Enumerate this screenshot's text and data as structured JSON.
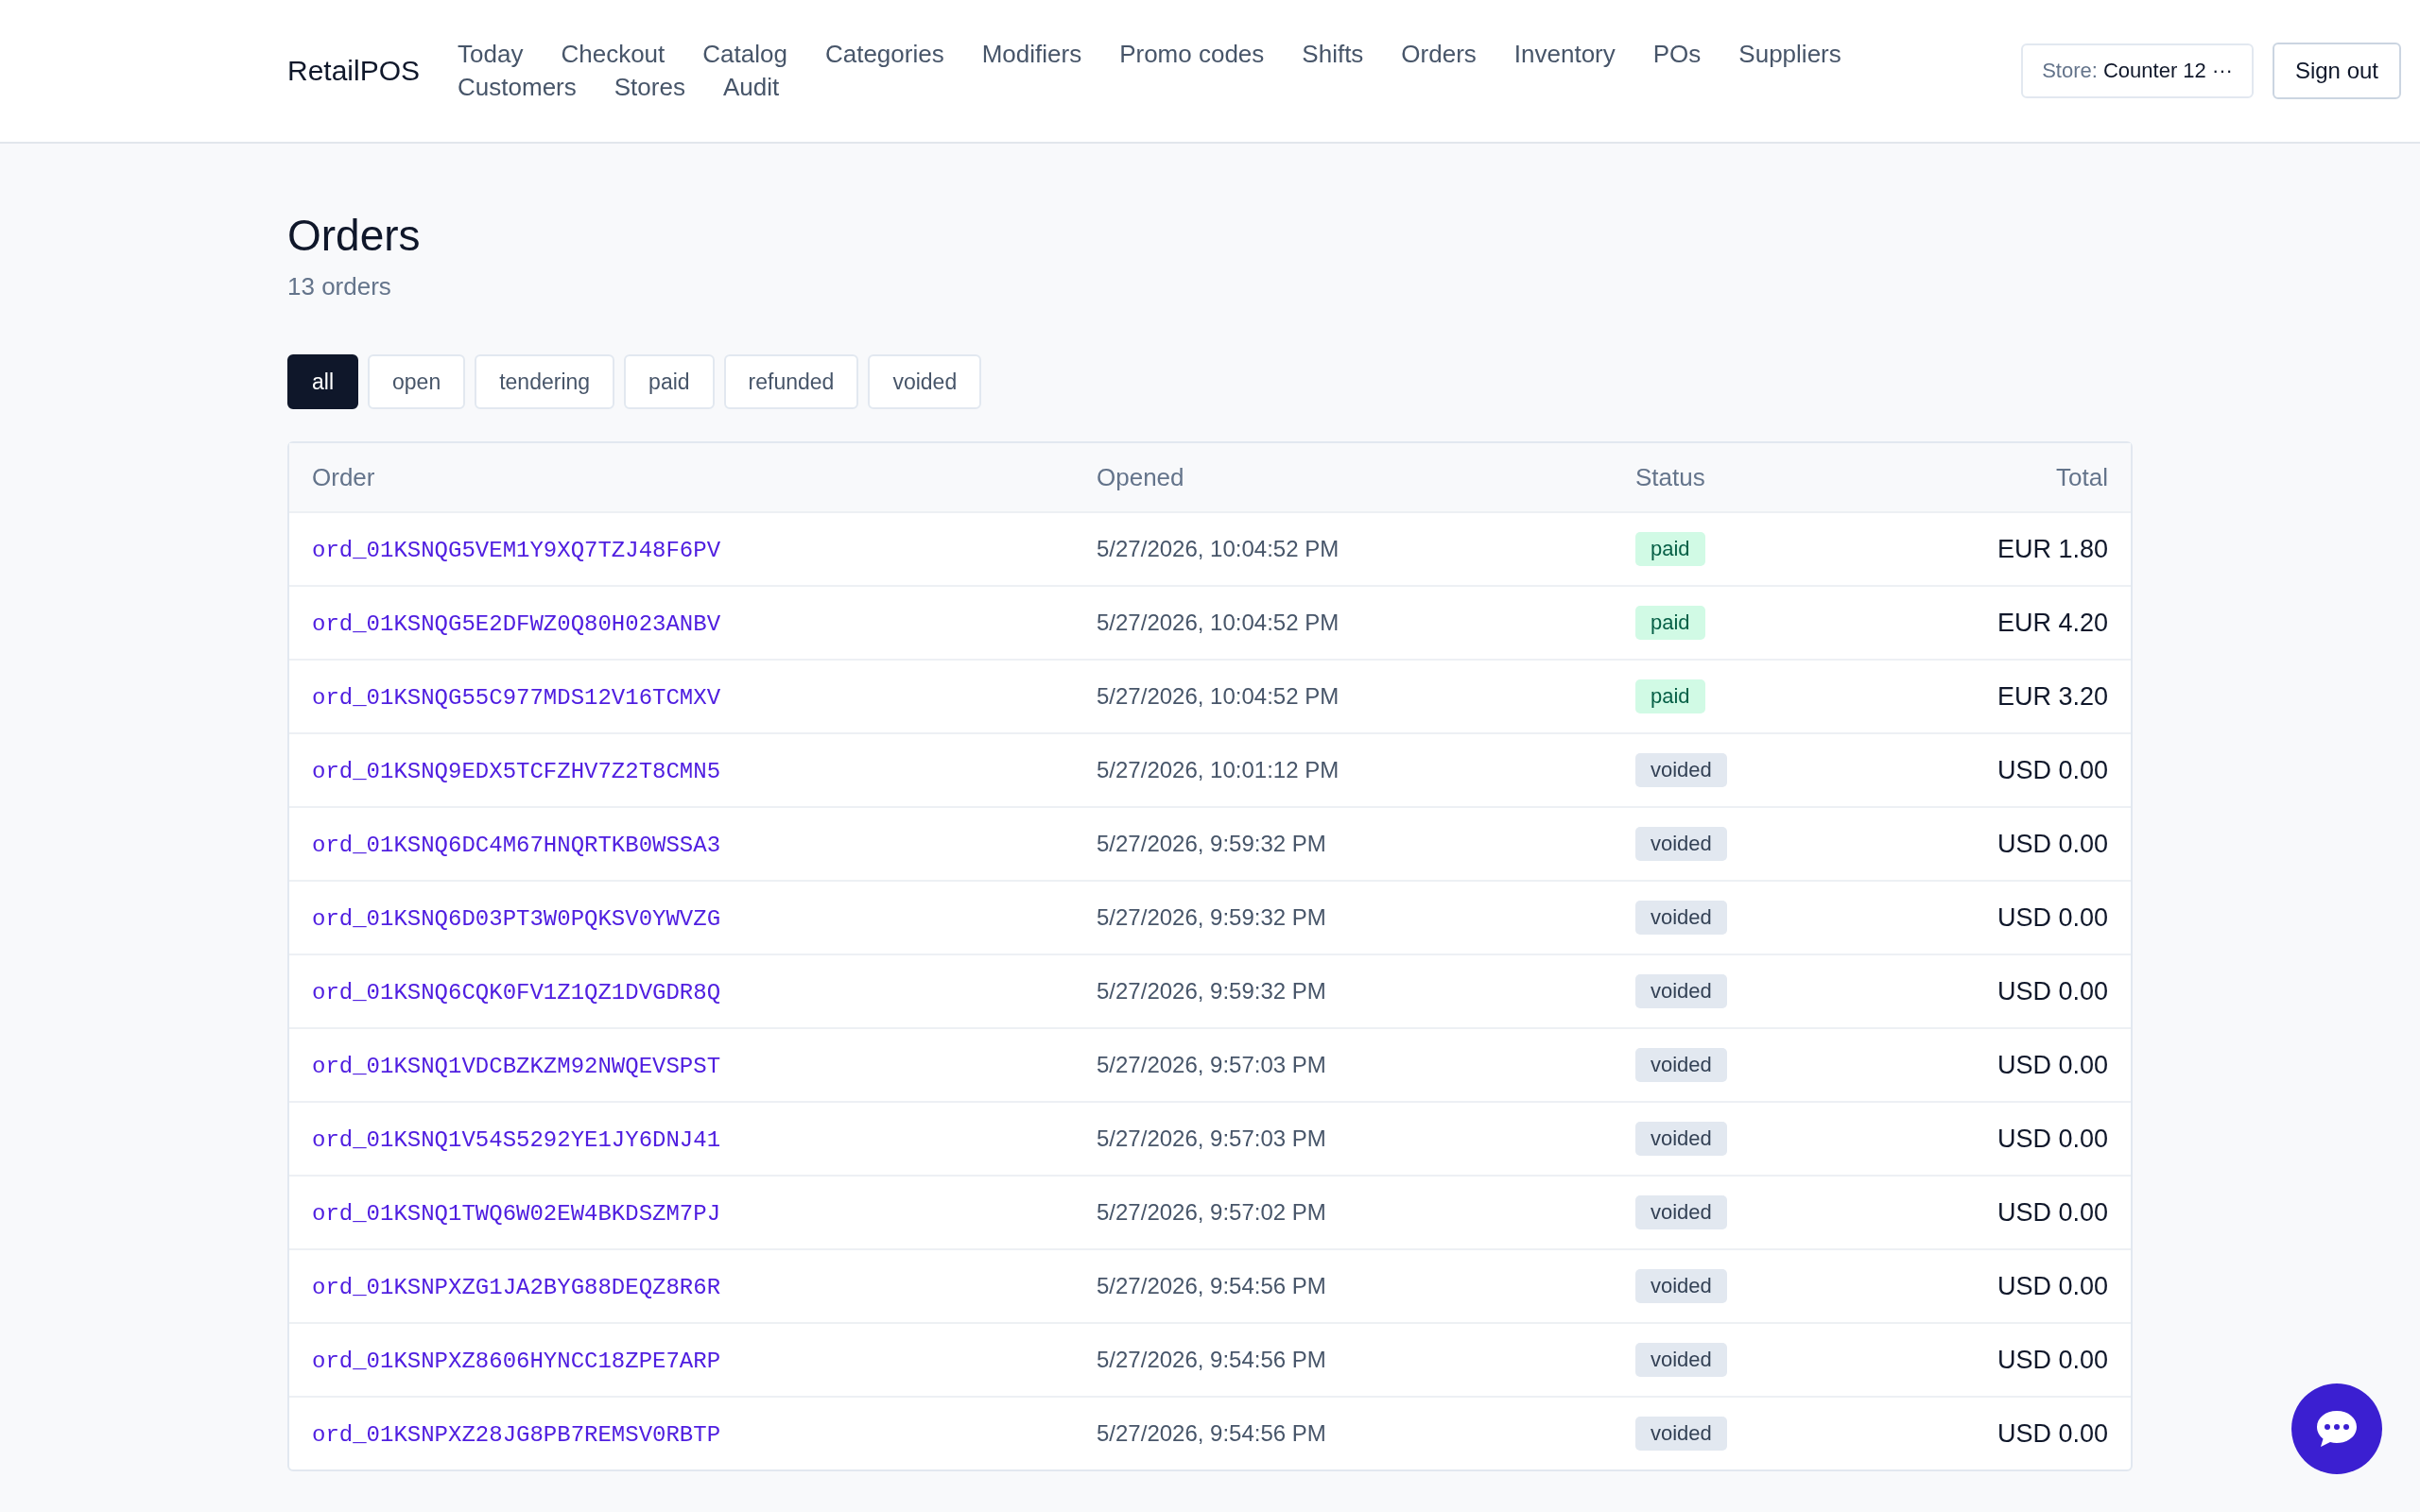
{
  "brand": "RetailPOS",
  "nav": [
    {
      "label": "Today",
      "selected": false
    },
    {
      "label": "Checkout",
      "selected": false
    },
    {
      "label": "Catalog",
      "selected": false
    },
    {
      "label": "Categories",
      "selected": false
    },
    {
      "label": "Modifiers",
      "selected": false
    },
    {
      "label": "Promo codes",
      "selected": false
    },
    {
      "label": "Shifts",
      "selected": false
    },
    {
      "label": "Orders",
      "selected": false
    },
    {
      "label": "Inventory",
      "selected": false
    },
    {
      "label": "POs",
      "selected": false
    },
    {
      "label": "Suppliers",
      "selected": false
    },
    {
      "label": "Customers",
      "selected": false
    },
    {
      "label": "Stores",
      "selected": false
    },
    {
      "label": "Audit",
      "selected": false
    }
  ],
  "store_select": {
    "label": "Store:",
    "value": "Counter 12 ···"
  },
  "sign_out": "Sign out",
  "page": {
    "title": "Orders",
    "subtitle": "13 orders"
  },
  "filters": [
    {
      "label": "all",
      "selected": true
    },
    {
      "label": "open",
      "selected": false
    },
    {
      "label": "tendering",
      "selected": false
    },
    {
      "label": "paid",
      "selected": false
    },
    {
      "label": "refunded",
      "selected": false
    },
    {
      "label": "voided",
      "selected": false
    }
  ],
  "table": {
    "columns": [
      "Order",
      "Opened",
      "Status",
      "Total"
    ],
    "rows": [
      {
        "order": "ord_01KSNQG5VEM1Y9XQ7TZJ48F6PV",
        "opened": "5/27/2026, 10:04:52 PM",
        "status": "paid",
        "kind": "paid",
        "total": "EUR 1.80"
      },
      {
        "order": "ord_01KSNQG5E2DFWZ0Q80H023ANBV",
        "opened": "5/27/2026, 10:04:52 PM",
        "status": "paid",
        "kind": "paid",
        "total": "EUR 4.20"
      },
      {
        "order": "ord_01KSNQG55C977MDS12V16TCMXV",
        "opened": "5/27/2026, 10:04:52 PM",
        "status": "paid",
        "kind": "paid",
        "total": "EUR 3.20"
      },
      {
        "order": "ord_01KSNQ9EDX5TCFZHV7Z2T8CMN5",
        "opened": "5/27/2026, 10:01:12 PM",
        "status": "voided",
        "kind": "voided",
        "total": "USD 0.00"
      },
      {
        "order": "ord_01KSNQ6DC4M67HNQRTKB0WSSA3",
        "opened": "5/27/2026, 9:59:32 PM",
        "status": "voided",
        "kind": "voided",
        "total": "USD 0.00"
      },
      {
        "order": "ord_01KSNQ6D03PT3W0PQKSV0YWVZG",
        "opened": "5/27/2026, 9:59:32 PM",
        "status": "voided",
        "kind": "voided",
        "total": "USD 0.00"
      },
      {
        "order": "ord_01KSNQ6CQK0FV1Z1QZ1DVGDR8Q",
        "opened": "5/27/2026, 9:59:32 PM",
        "status": "voided",
        "kind": "voided",
        "total": "USD 0.00"
      },
      {
        "order": "ord_01KSNQ1VDCBZKZM92NWQEVSPST",
        "opened": "5/27/2026, 9:57:03 PM",
        "status": "voided",
        "kind": "voided",
        "total": "USD 0.00"
      },
      {
        "order": "ord_01KSNQ1V54S5292YE1JY6DNJ41",
        "opened": "5/27/2026, 9:57:03 PM",
        "status": "voided",
        "kind": "voided",
        "total": "USD 0.00"
      },
      {
        "order": "ord_01KSNQ1TWQ6W02EW4BKDSZM7PJ",
        "opened": "5/27/2026, 9:57:02 PM",
        "status": "voided",
        "kind": "voided",
        "total": "USD 0.00"
      },
      {
        "order": "ord_01KSNPXZG1JA2BYG88DEQZ8R6R",
        "opened": "5/27/2026, 9:54:56 PM",
        "status": "voided",
        "kind": "voided",
        "total": "USD 0.00"
      },
      {
        "order": "ord_01KSNPXZ8606HYNCC18ZPE7ARP",
        "opened": "5/27/2026, 9:54:56 PM",
        "status": "voided",
        "kind": "voided",
        "total": "USD 0.00"
      },
      {
        "order": "ord_01KSNPXZ28JG8PB7REMSV0RBTP",
        "opened": "5/27/2026, 9:54:56 PM",
        "status": "voided",
        "kind": "voided",
        "total": "USD 0.00"
      }
    ]
  }
}
